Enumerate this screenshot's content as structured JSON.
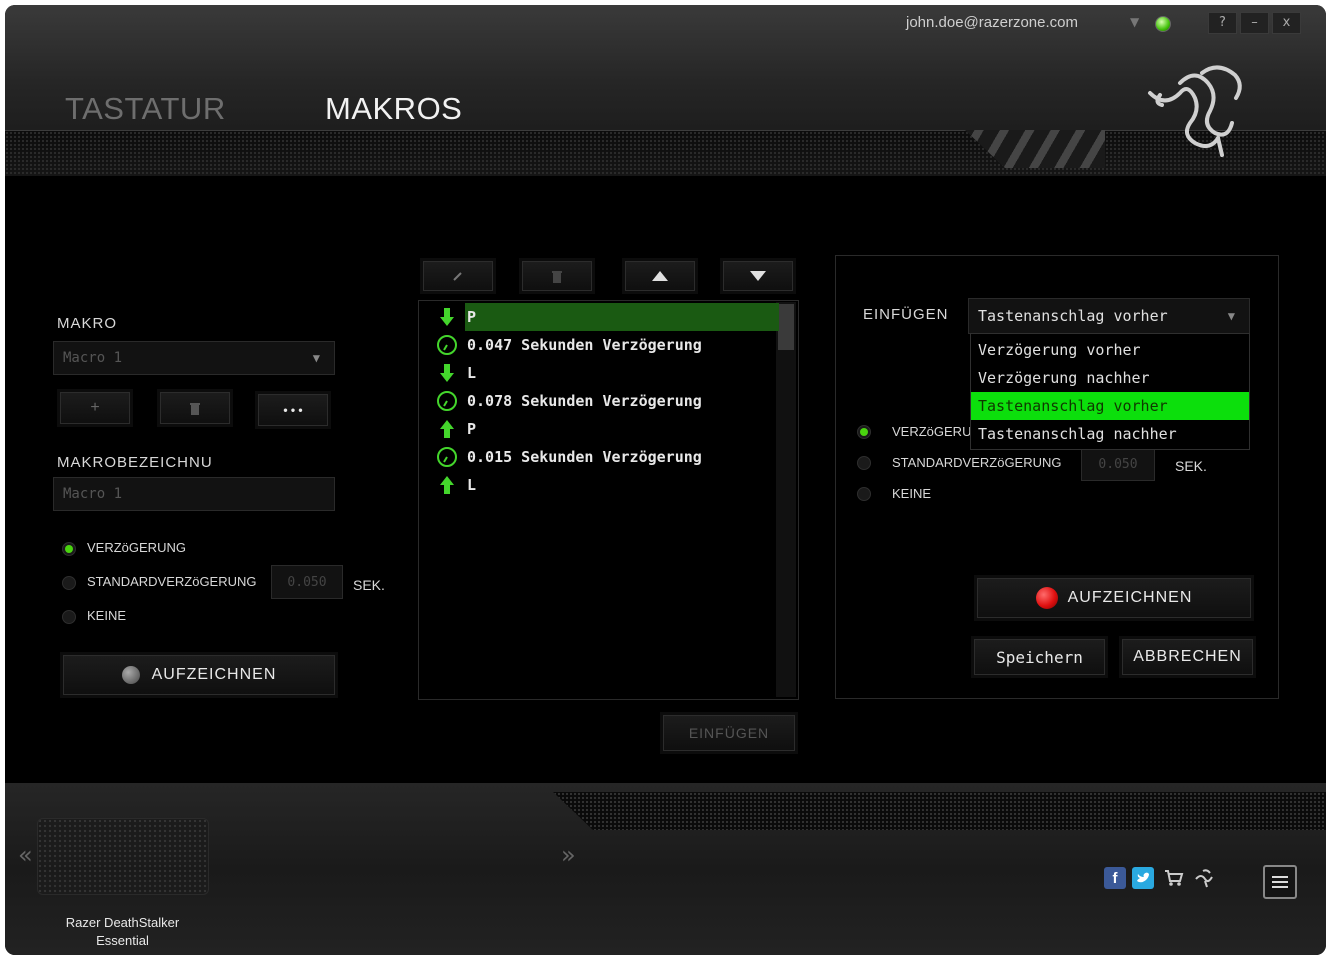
{
  "header": {
    "tabs": [
      {
        "label": "TASTATUR"
      },
      {
        "label": "MAKROS"
      }
    ],
    "user_email": "john.doe@razerzone.com",
    "window_buttons": [
      "?",
      "–",
      "x"
    ]
  },
  "left": {
    "makro_label": "MAKRO",
    "makro_select_value": "Macro 1",
    "add_label": "+",
    "more_label": "• • •",
    "name_label": "MAKROBEZEICHNU",
    "name_value": "Macro 1",
    "delay_options": [
      "VERZöGERUNG",
      "STANDARDVERZöGERUNG",
      "KEINE"
    ],
    "delay_selected": 0,
    "default_delay_value": "0.050",
    "sek_label": "SEK.",
    "record_label": "AUFZEICHNEN"
  },
  "middle": {
    "toolbar": [
      "edit",
      "delete",
      "move-up",
      "move-down"
    ],
    "rows": [
      {
        "type": "down",
        "text": "P"
      },
      {
        "type": "delay",
        "text": "0.047 Sekunden Verzögerung"
      },
      {
        "type": "down",
        "text": "L"
      },
      {
        "type": "delay",
        "text": "0.078 Sekunden Verzögerung"
      },
      {
        "type": "up",
        "text": "P"
      },
      {
        "type": "delay",
        "text": "0.015 Sekunden Verzögerung"
      },
      {
        "type": "up",
        "text": "L"
      }
    ],
    "selected_row": 0,
    "insert_button": "EINFÜGEN"
  },
  "right": {
    "insert_label": "EINFÜGEN",
    "insert_select_value": "Tastenanschlag vorher",
    "dropdown_options": [
      "Verzögerung vorher",
      "Verzögerung nachher",
      "Tastenanschlag vorher",
      "Tastenanschlag nachher"
    ],
    "dropdown_highlight": 2,
    "delay_options": [
      "VERZöGERU",
      "STANDARDVERZöGERUNG",
      "KEINE"
    ],
    "delay_selected": 0,
    "default_delay_value": "0.050",
    "sek_label": "SEK.",
    "record_label": "AUFZEICHNEN",
    "save_label": "Speichern",
    "cancel_label": "ABBRECHEN"
  },
  "footer": {
    "device_name_line1": "Razer DeathStalker",
    "device_name_line2": "Essential",
    "prev_arrow": "«",
    "next_arrow": "»"
  },
  "colors": {
    "accent_green": "#44d62c",
    "highlight_green": "#0cdf0c",
    "record_red": "#e01010"
  }
}
